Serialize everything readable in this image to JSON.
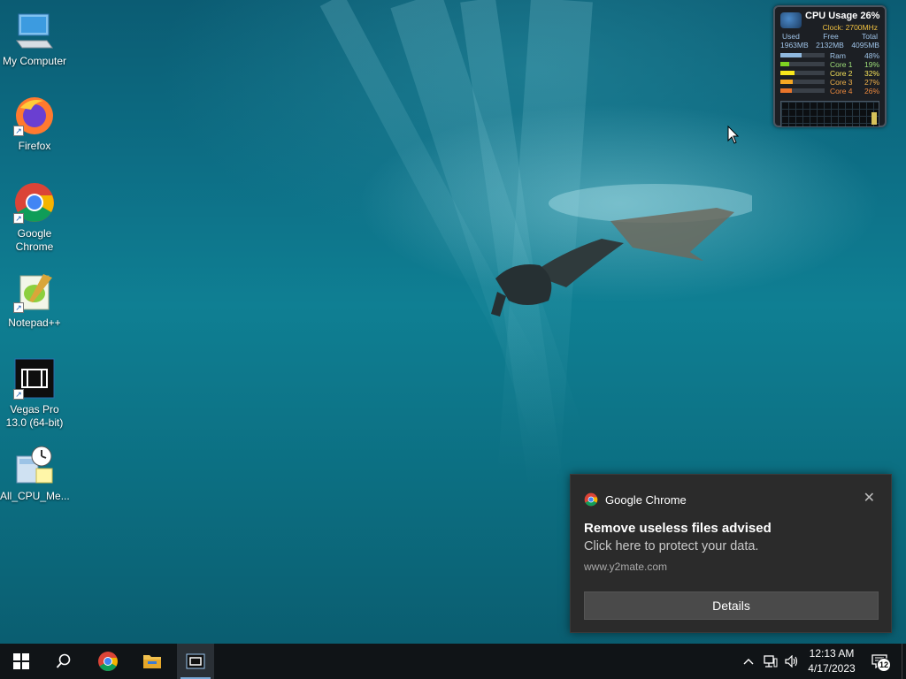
{
  "desktop": {
    "icons": [
      {
        "label": "My Computer"
      },
      {
        "label": "Firefox"
      },
      {
        "label": "Google Chrome"
      },
      {
        "label": "Notepad++"
      },
      {
        "label": "Vegas Pro 13.0 (64-bit)"
      },
      {
        "label": "All_CPU_Me..."
      }
    ]
  },
  "gadget": {
    "title": "CPU Usage",
    "usage": "26%",
    "clock": "Clock: 2700MHz",
    "mem_headers": [
      "Used",
      "Free",
      "Total"
    ],
    "mem_values": [
      "1963MB",
      "2132MB",
      "4095MB"
    ],
    "bars": [
      {
        "name": "Ram",
        "value": "48%",
        "level": 48,
        "color": "#8fb8de"
      },
      {
        "name": "Core 1",
        "value": "19%",
        "level": 19,
        "color": "#7ed321"
      },
      {
        "name": "Core 2",
        "value": "32%",
        "level": 32,
        "color": "#f8e71c"
      },
      {
        "name": "Core 3",
        "value": "27%",
        "level": 27,
        "color": "#f5a623"
      },
      {
        "name": "Core 4",
        "value": "26%",
        "level": 26,
        "color": "#e8742a"
      }
    ]
  },
  "toast": {
    "app": "Google Chrome",
    "title": "Remove useless files advised",
    "body": "Click here to protect your data.",
    "source": "www.y2mate.com",
    "button": "Details",
    "close_glyph": "✕"
  },
  "taskbar": {
    "time": "12:13 AM",
    "date": "4/17/2023",
    "notification_count": "12",
    "accent": "#7aa9d6"
  }
}
